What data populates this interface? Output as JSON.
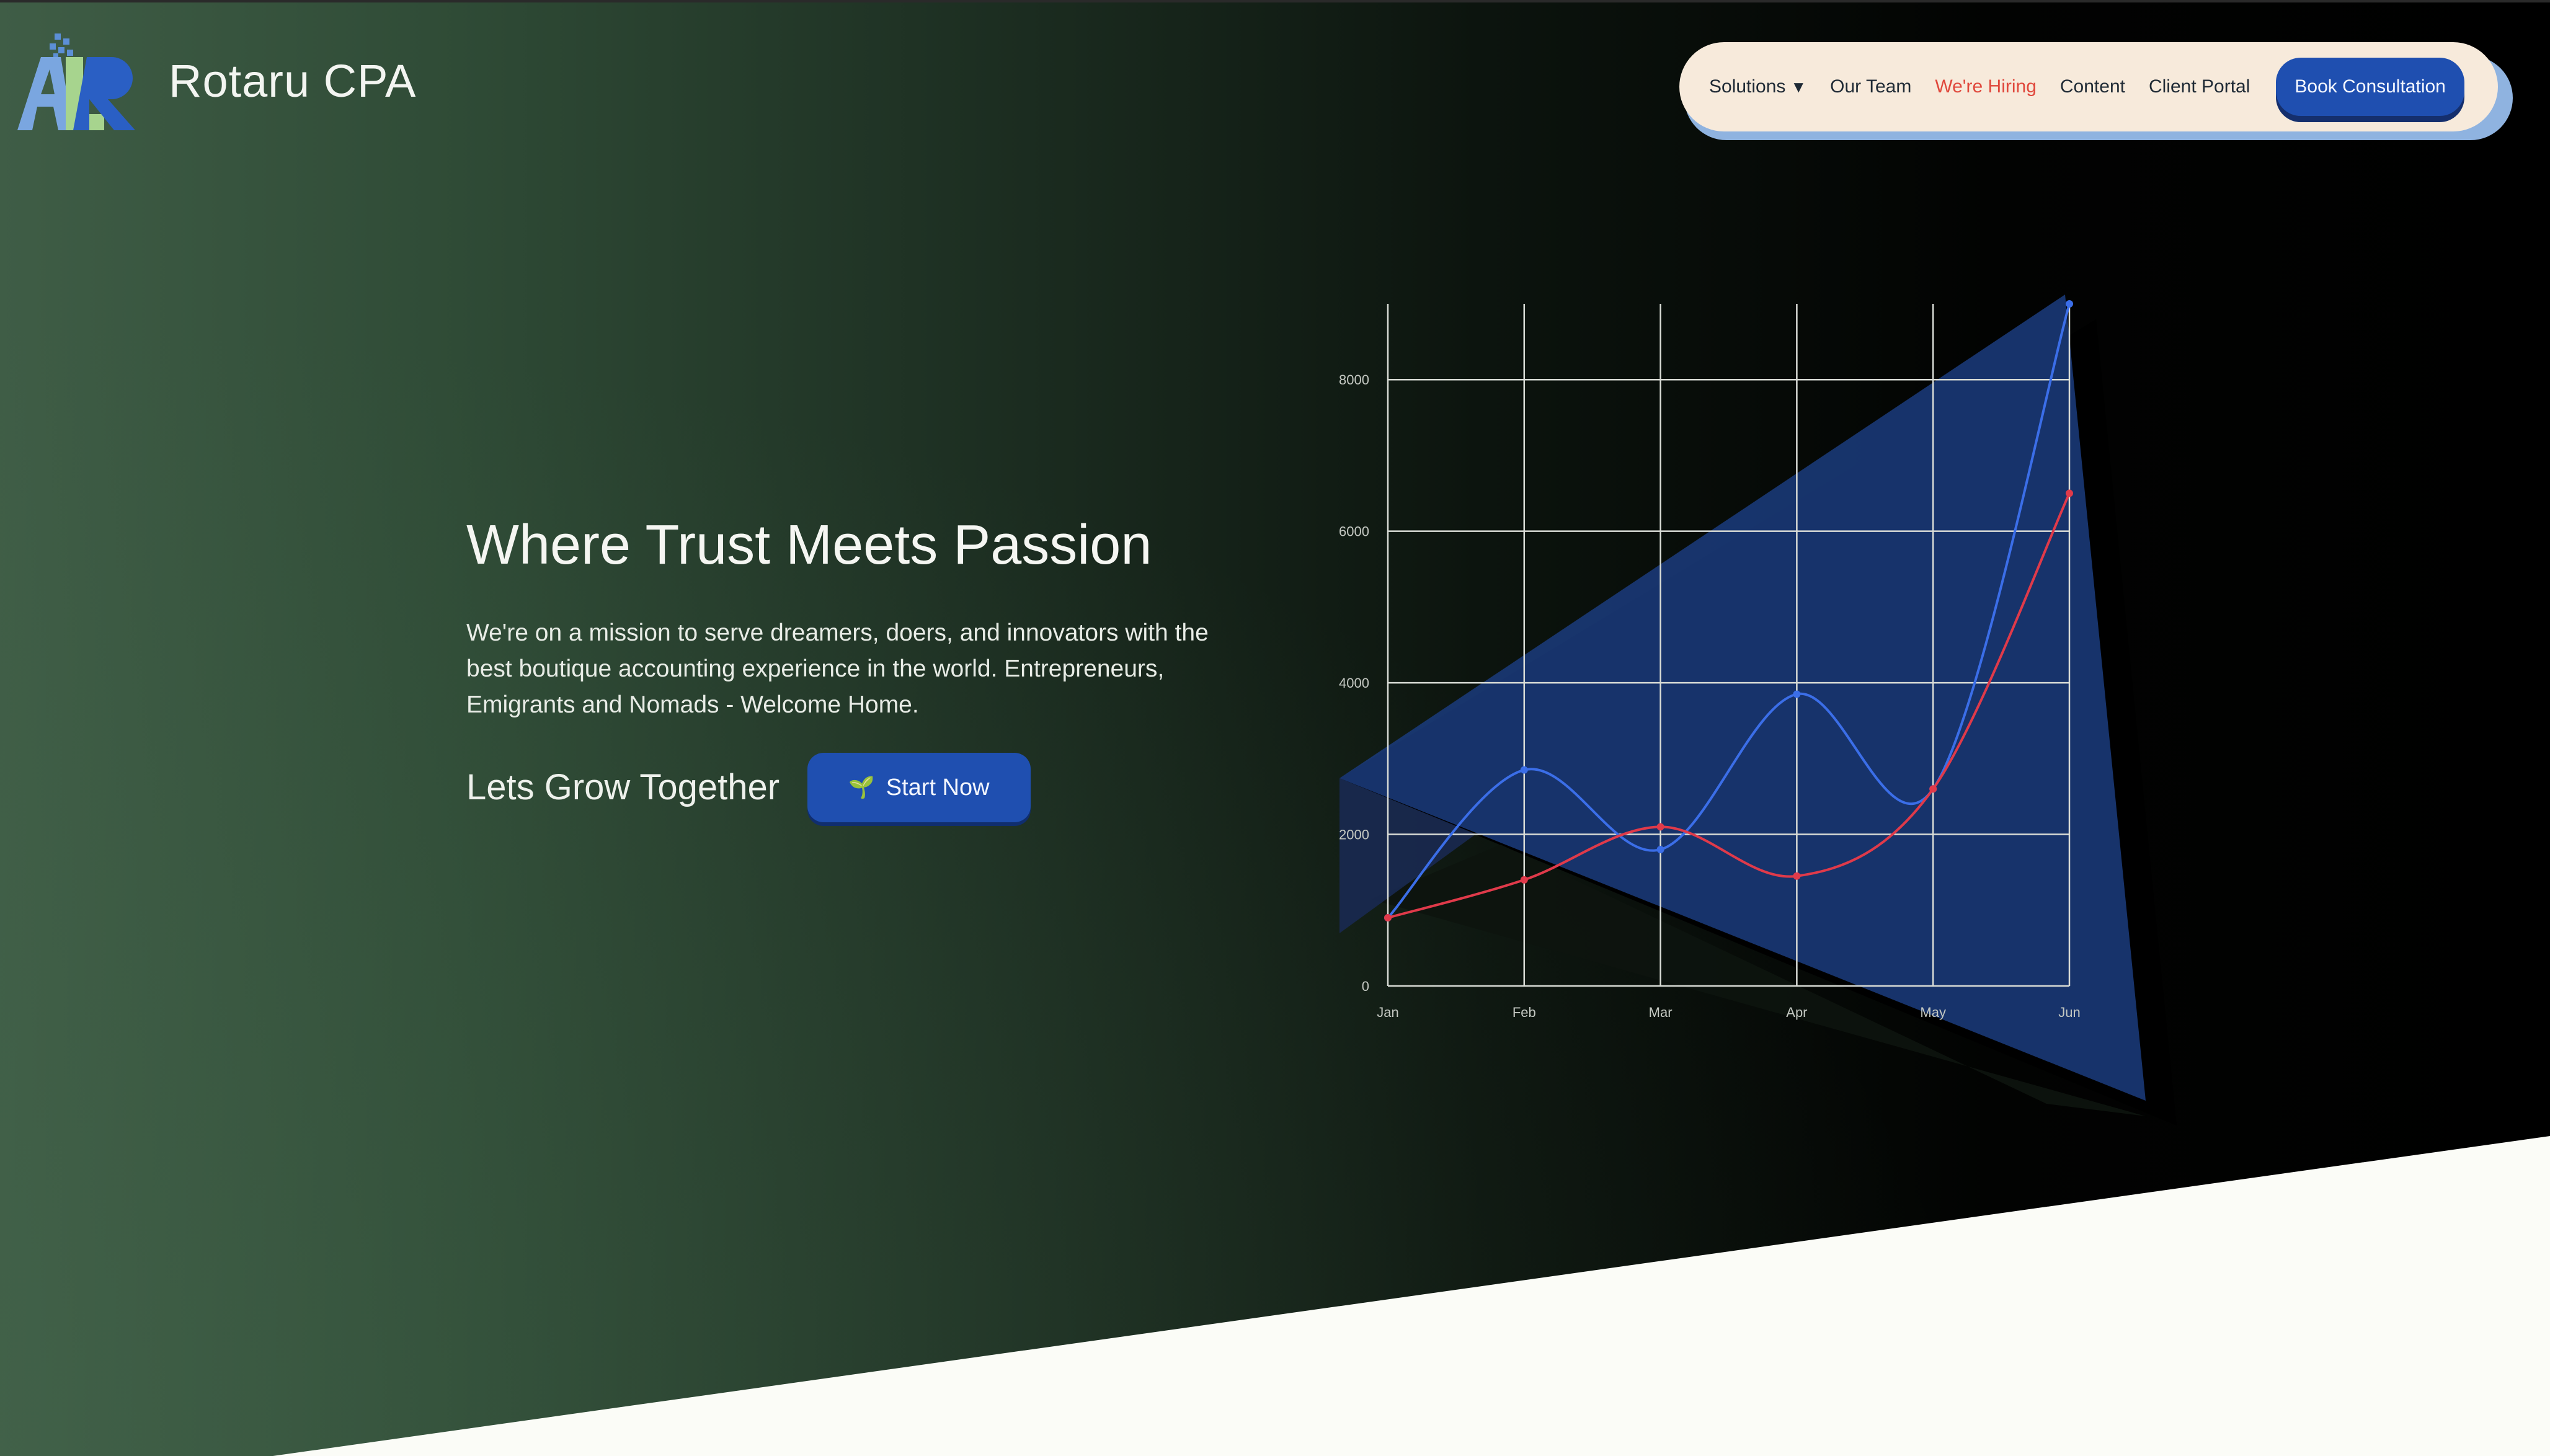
{
  "brand": {
    "name": "Rotaru CPA",
    "logo_icon": "alr-monogram-logo"
  },
  "nav": {
    "items": [
      {
        "label": "Solutions",
        "icon": "caret-down"
      },
      {
        "label": "Our Team"
      },
      {
        "label": "We're Hiring",
        "color": "#e0483c"
      },
      {
        "label": "Content"
      },
      {
        "label": "Client Portal"
      }
    ],
    "cta": "Book Consultation"
  },
  "hero": {
    "headline": "Where Trust Meets Passion",
    "subtext": "We're on a mission to serve dreamers, doers, and innovators with the best boutique accounting experience in the world. Entrepreneurs, Emigrants and Nomads - Welcome Home.",
    "grow_label": "Lets Grow Together",
    "start_button": "Start Now",
    "start_icon": "sprout-icon"
  },
  "colors": {
    "accent_blue": "#1f4fb0",
    "series_blue": "#3b6ee8",
    "series_red": "#e03a4a",
    "nav_bg": "#f7eadb"
  },
  "chart_data": {
    "type": "line",
    "categories": [
      "Jan",
      "Feb",
      "Mar",
      "Apr",
      "May",
      "Jun"
    ],
    "series": [
      {
        "values": [
          900,
          2850,
          1800,
          3850,
          2600,
          9000
        ],
        "color": "#3b6ee8"
      },
      {
        "values": [
          900,
          1400,
          2100,
          1450,
          2600,
          6500
        ],
        "color": "#e03a4a"
      }
    ],
    "ylim": [
      0,
      9000
    ],
    "yticks": [
      "0",
      "2000",
      "4000",
      "6000",
      "8000"
    ],
    "grid": true,
    "smooth": true
  }
}
